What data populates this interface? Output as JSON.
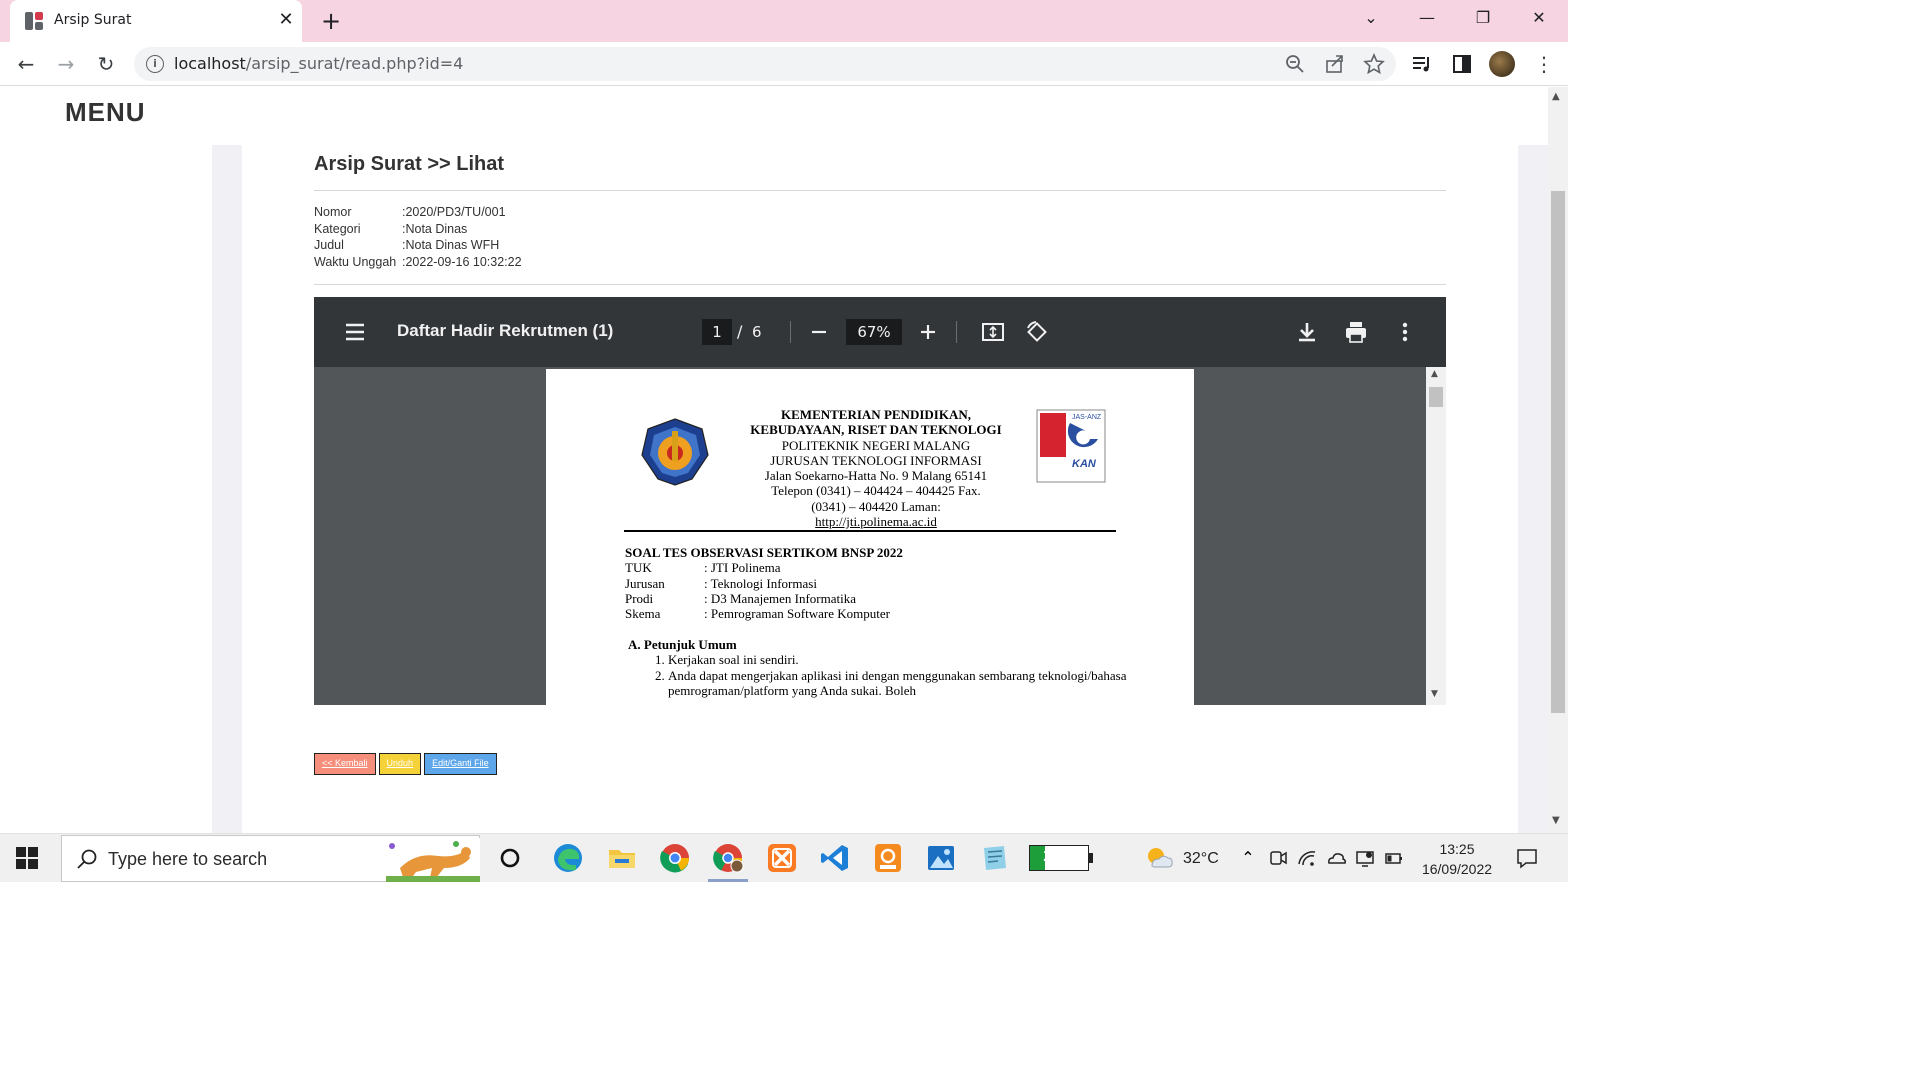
{
  "browser": {
    "tab_title": "Arsip Surat",
    "url_host": "localhost",
    "url_path": "/arsip_surat/read.php?id=4"
  },
  "sidebar": {
    "menu_label": "MENU"
  },
  "main": {
    "heading": "Arsip Surat >> Lihat",
    "meta": [
      {
        "key": "Nomor",
        "value": ":2020/PD3/TU/001"
      },
      {
        "key": "Kategori",
        "value": ":Nota Dinas"
      },
      {
        "key": "Judul",
        "value": ":Nota Dinas WFH"
      },
      {
        "key": "Waktu Unggah",
        "value": ":2022-09-16 10:32:22"
      }
    ],
    "buttons": {
      "back": "<< Kembali",
      "download": "Unduh",
      "edit": "Edit/Ganti File"
    }
  },
  "pdf_viewer": {
    "doc_title": "Daftar Hadir Rekrutmen (1)",
    "current_page": "1",
    "separator": "/",
    "total_pages": "6",
    "zoom": "67%",
    "document": {
      "kop_lines": [
        "KEMENTERIAN PENDIDIKAN,",
        "KEBUDAYAAN, RISET DAN TEKNOLOGI",
        "POLITEKNIK NEGERI MALANG",
        "JURUSAN TEKNOLOGI INFORMASI",
        "Jalan Soekarno-Hatta No. 9 Malang 65141",
        "Telepon (0341) – 404424 – 404425 Fax.",
        "(0341) – 404420 Laman:",
        "http://jti.polinema.ac.id"
      ],
      "soal_title": "SOAL TES OBSERVASI SERTIKOM BNSP 2022",
      "soal_rows": [
        {
          "key": "TUK",
          "value": ": JTI Polinema"
        },
        {
          "key": "Jurusan",
          "value": ": Teknologi Informasi"
        },
        {
          "key": "Prodi",
          "value": ": D3 Manajemen Informatika"
        },
        {
          "key": "Skema",
          "value": ": Pemrograman Software Komputer"
        }
      ],
      "section_title": "A.  Petunjuk Umum",
      "section_items": [
        "Kerjakan soal ini sendiri.",
        "Anda dapat mengerjakan aplikasi ini dengan menggunakan sembarang teknologi/bahasa pemrograman/platform yang Anda sukai. Boleh"
      ],
      "logo_right_text": "JAS-ANZ",
      "logo_right_kan": "KAN"
    }
  },
  "taskbar": {
    "search_placeholder": "Type here to search",
    "battery": "26%",
    "battery_level": 0.26,
    "temperature": "32°C",
    "time": "13:25",
    "date": "16/09/2022"
  },
  "colors": {
    "tabbar": "#f6d4e2",
    "pdf_toolbar": "#323639",
    "btn_back": "#f58f7c",
    "btn_download": "#f5d23a",
    "btn_edit": "#5ea6ea"
  }
}
